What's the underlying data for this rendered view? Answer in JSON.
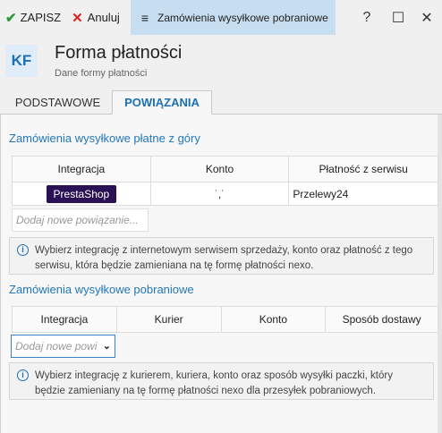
{
  "toolbar": {
    "save_label": "ZAPISZ",
    "cancel_label": "Anuluj",
    "active_tab_label": "Zamówienia wysyłkowe pobraniowe",
    "help_glyph": "?",
    "maximize_glyph": "☐",
    "close_glyph": "✕"
  },
  "header": {
    "badge": "KF",
    "title": "Forma płatności",
    "subtitle": "Dane formy płatności"
  },
  "tabs": [
    {
      "label": "PODSTAWOWE",
      "active": false
    },
    {
      "label": "POWIĄZANIA",
      "active": true
    }
  ],
  "section1": {
    "title": "Zamówienia wysyłkowe płatne z góry",
    "columns": [
      "Integracja",
      "Konto",
      "Płatność z serwisu"
    ],
    "rows": [
      {
        "integration": "PrestaShop",
        "account": "˙,˙",
        "payment": "Przelewy24"
      }
    ],
    "add_placeholder": "Dodaj nowe powiązanie...",
    "info": "Wybierz integrację z internetowym serwisem sprzedaży, konto oraz płatność z tego serwisu, która będzie zamieniana na tę formę płatności nexo."
  },
  "section2": {
    "title": "Zamówienia wysyłkowe pobraniowe",
    "columns": [
      "Integracja",
      "Kurier",
      "Konto",
      "Sposób dostawy"
    ],
    "add_placeholder": "Dodaj nowe powi",
    "info": "Wybierz integrację z kurierem, kuriera, konto oraz sposób wysyłki paczki, który będzie zamieniany na tę formę płatności nexo dla przesyłek pobraniowych."
  },
  "colors": {
    "accent": "#1b6fb5",
    "active_tab_bg": "#c7def1",
    "prestashop_bg": "#2a1054"
  }
}
